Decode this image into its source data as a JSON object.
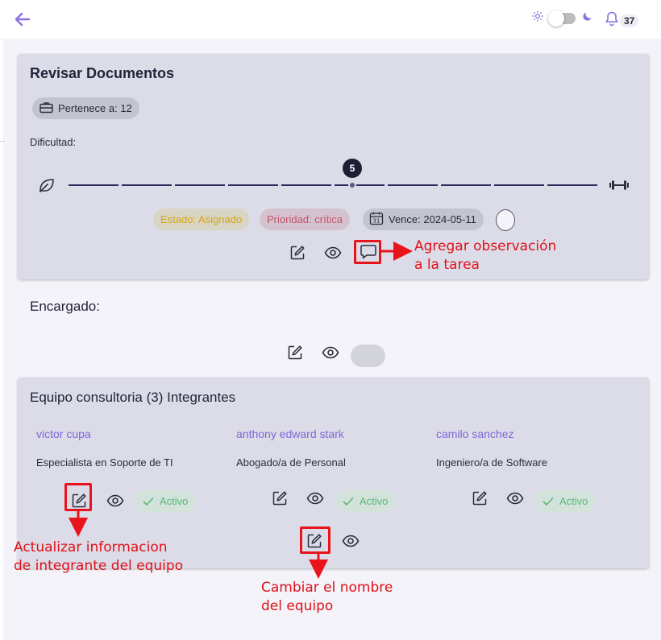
{
  "notifications": {
    "count": "37"
  },
  "task": {
    "title": "Revisar Documentos",
    "belongs_to": "Pertenece a: 12",
    "difficulty_label": "Dificultad:",
    "difficulty_value": "5",
    "status": "Estado: Asignado",
    "priority": "Prioridad: crítica",
    "due": "Vence: 2024-05-11"
  },
  "assignee": {
    "label": "Encargado:"
  },
  "team": {
    "title": "Equipo consultoria (3) Integrantes",
    "members": [
      {
        "name": "victor cupa",
        "role": "Especialista en Soporte de TI",
        "status": "Activo"
      },
      {
        "name": "anthony edward stark",
        "role": "Abogado/a de Personal",
        "status": "Activo"
      },
      {
        "name": "camilo sanchez",
        "role": "Ingeniero/a de Software",
        "status": "Activo"
      }
    ]
  },
  "annotations": {
    "add_observation": [
      "Agregar observación",
      "a la tarea"
    ],
    "update_member": [
      "Actualizar informacion",
      "de integrante del equipo"
    ],
    "rename_team": [
      "Cambiar el nombre",
      "del equipo"
    ]
  },
  "colors": {
    "accent": "#7b68d8",
    "status_yellow": "#d9a514",
    "priority_red": "#c2536a",
    "active_green": "#5bb97a",
    "annotation_red": "#e8141b"
  },
  "icons": [
    "arrow-left-icon",
    "sun-icon",
    "moon-icon",
    "bell-icon",
    "briefcase-icon",
    "leaf-icon",
    "dumbbell-icon",
    "calendar-icon",
    "edit-icon",
    "eye-icon",
    "comment-icon",
    "check-icon"
  ]
}
